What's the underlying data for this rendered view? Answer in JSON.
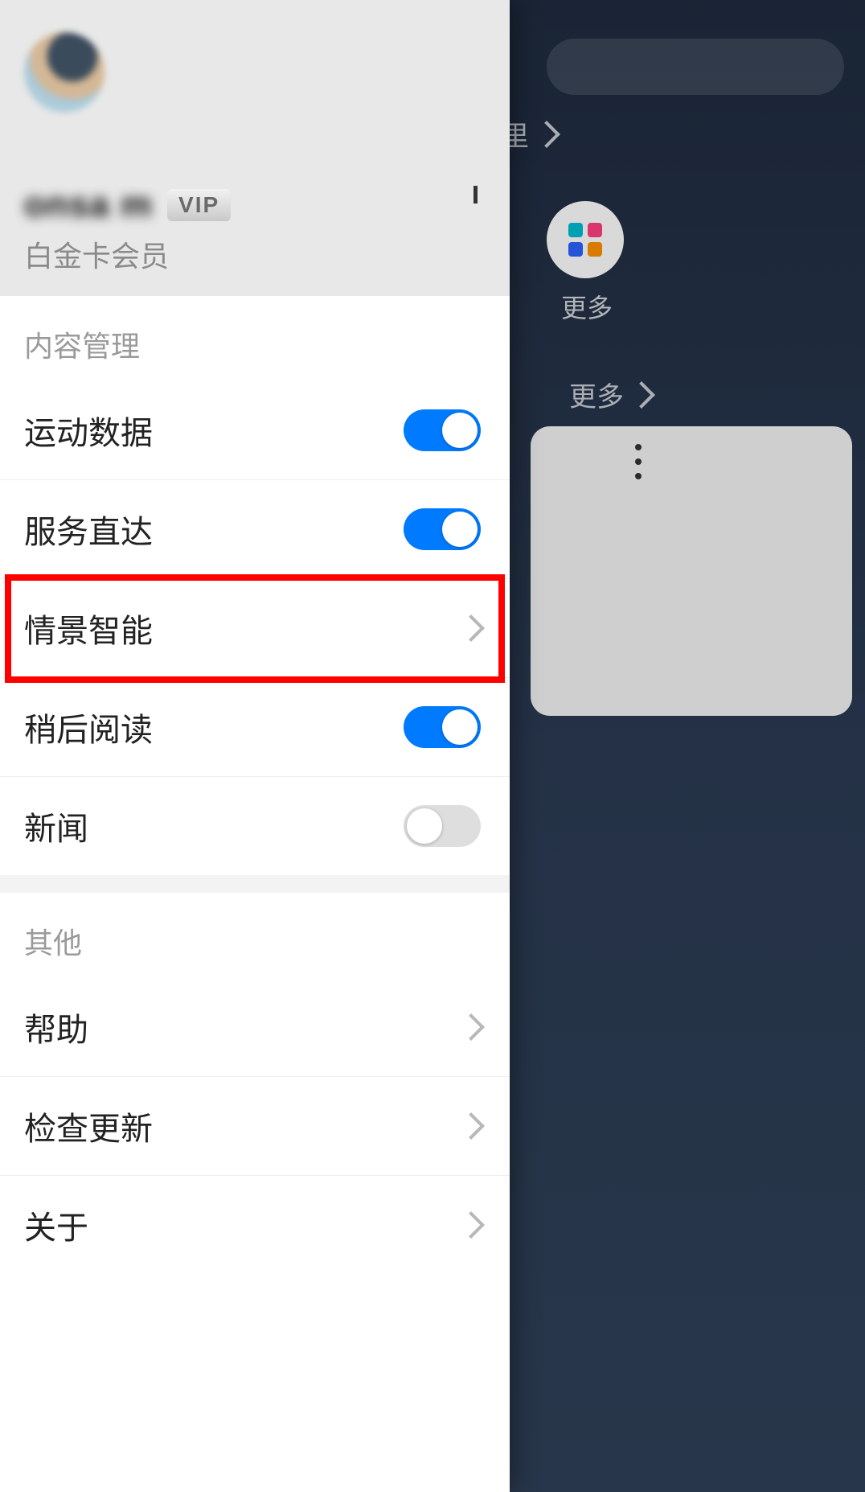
{
  "profile": {
    "username": "onsa    m",
    "vip_badge": "VIP",
    "member_tier": "白金卡会员"
  },
  "sections": {
    "content": {
      "header": "内容管理",
      "items": {
        "sports_data": {
          "label": "运动数据",
          "on": true
        },
        "service_direct": {
          "label": "服务直达",
          "on": true
        },
        "scene_ai": {
          "label": "情景智能"
        },
        "read_later": {
          "label": "稍后阅读",
          "on": true
        },
        "news": {
          "label": "新闻",
          "on": false
        }
      }
    },
    "other": {
      "header": "其他",
      "items": {
        "help": {
          "label": "帮助"
        },
        "update": {
          "label": "检查更新"
        },
        "about": {
          "label": "关于"
        }
      }
    }
  },
  "background": {
    "breadcrumb_text": "里",
    "more_label": "更多",
    "more_link": "更多"
  },
  "highlight": "scene_ai"
}
